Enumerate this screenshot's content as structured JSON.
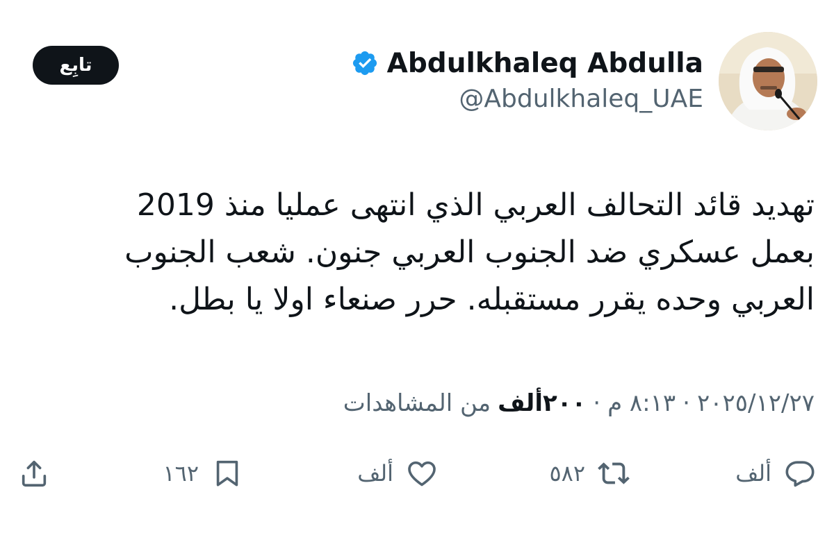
{
  "author": {
    "display_name": "Abdulkhaleq Abdulla",
    "handle": "@Abdulkhaleq_UAE",
    "verified_icon": "verified-badge-icon",
    "avatar_icon": "avatar"
  },
  "follow_button": {
    "label": "تابِع"
  },
  "tweet": {
    "text": "تهديد قائد التحالف العربي الذي انتهى عمليا منذ 2019\nبعمل عسكري ضد الجنوب العربي جنون. شعب الجنوب\nالعربي وحده يقرر مستقبله. حرر صنعاء اولا يا بطل."
  },
  "meta": {
    "date": "٢٠٢٥/١٢/٢٧",
    "separator": "·",
    "time": "٨:١٣ م",
    "views_count": "٢٠٠ألف",
    "views_label": "من المشاهدات"
  },
  "actions": {
    "reply": {
      "icon": "reply-icon",
      "count": "ألف"
    },
    "retweet": {
      "icon": "retweet-icon",
      "count": "٥٨٢"
    },
    "like": {
      "icon": "heart-icon",
      "count": "ألف"
    },
    "bookmark": {
      "icon": "bookmark-icon",
      "count": "١٦٢"
    },
    "share": {
      "icon": "share-icon"
    }
  },
  "colors": {
    "text_primary": "#0f1419",
    "text_secondary": "#536471",
    "verified_blue": "#1d9bf0",
    "follow_bg": "#0f1419"
  }
}
